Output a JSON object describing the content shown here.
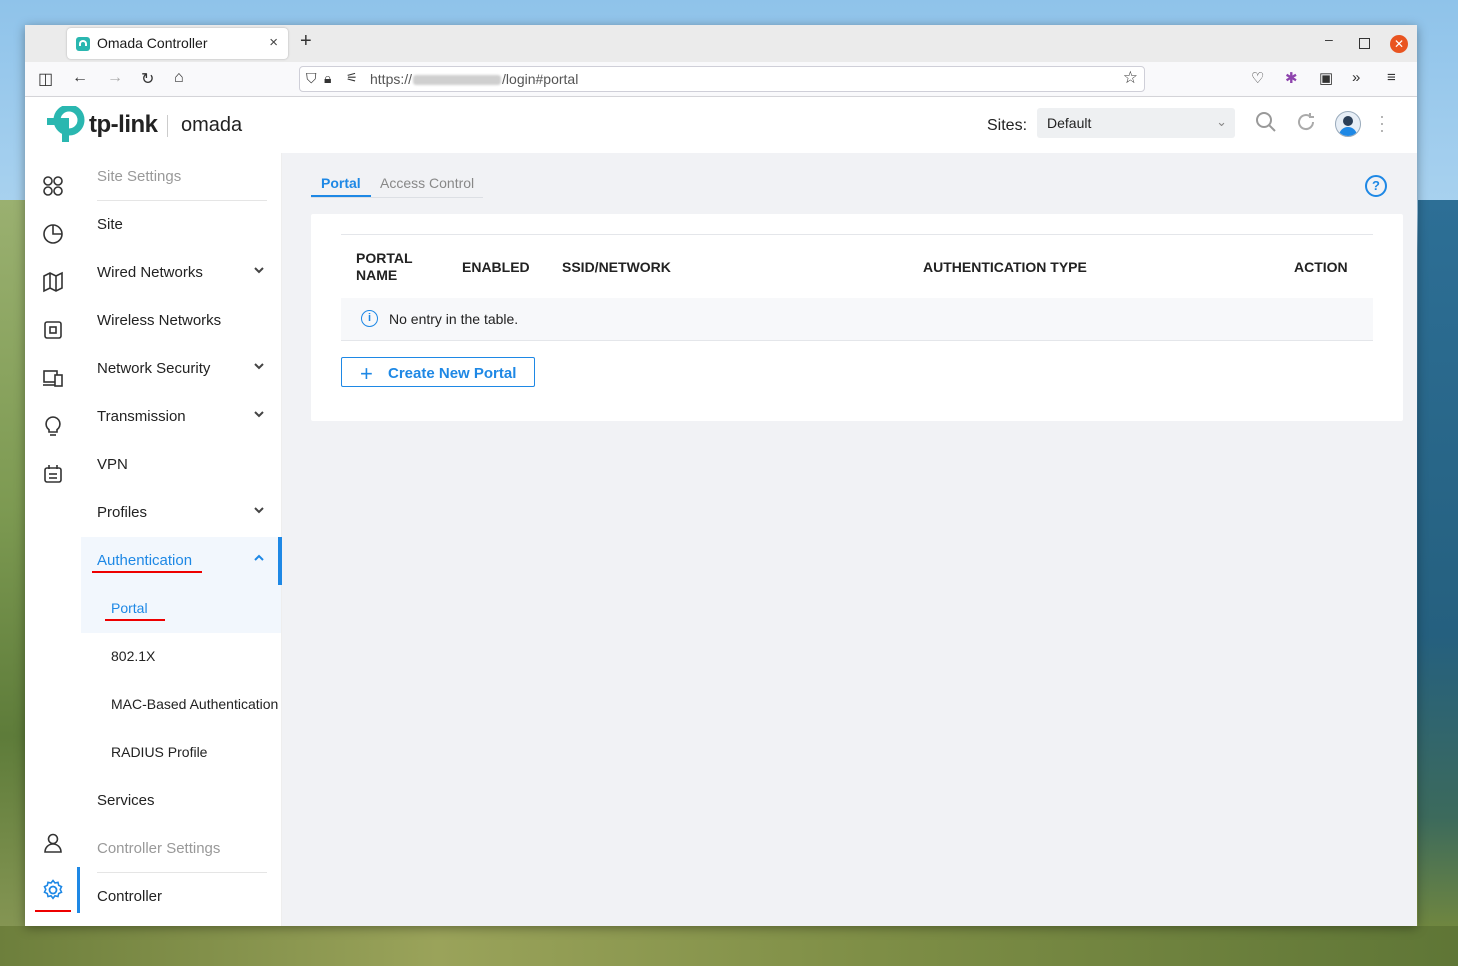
{
  "browser": {
    "tab_title": "Omada Controller",
    "tab_close": "×",
    "new_tab": "+",
    "url_prefix": "https://",
    "url_suffix": "/login#portal",
    "win_min": "–",
    "win_close": "✕"
  },
  "header": {
    "logo_tplink": "tp-link",
    "logo_omada": "omada",
    "sites_label": "Sites:",
    "sites_value": "Default"
  },
  "menu": {
    "site_settings": "Site Settings",
    "site": "Site",
    "wired_networks": "Wired Networks",
    "wireless_networks": "Wireless Networks",
    "network_security": "Network Security",
    "transmission": "Transmission",
    "vpn": "VPN",
    "profiles": "Profiles",
    "authentication": "Authentication",
    "portal": "Portal",
    "dot1x": "802.1X",
    "mac_auth": "MAC-Based Authentication",
    "radius_profile": "RADIUS Profile",
    "services": "Services",
    "controller_settings": "Controller Settings",
    "controller": "Controller"
  },
  "main": {
    "tabs": [
      "Portal",
      "Access Control"
    ],
    "help": "?",
    "table": {
      "headers": [
        "PORTAL NAME",
        "ENABLED",
        "SSID/NETWORK",
        "AUTHENTICATION TYPE",
        "ACTION"
      ],
      "header_portal_line1": "PORTAL",
      "header_portal_line2": "NAME",
      "empty_text": "No entry in the table."
    },
    "create_button": "Create New Portal"
  },
  "colors": {
    "accent": "#1e88e5",
    "annotation": "#e00000",
    "close_button": "#e95420"
  }
}
